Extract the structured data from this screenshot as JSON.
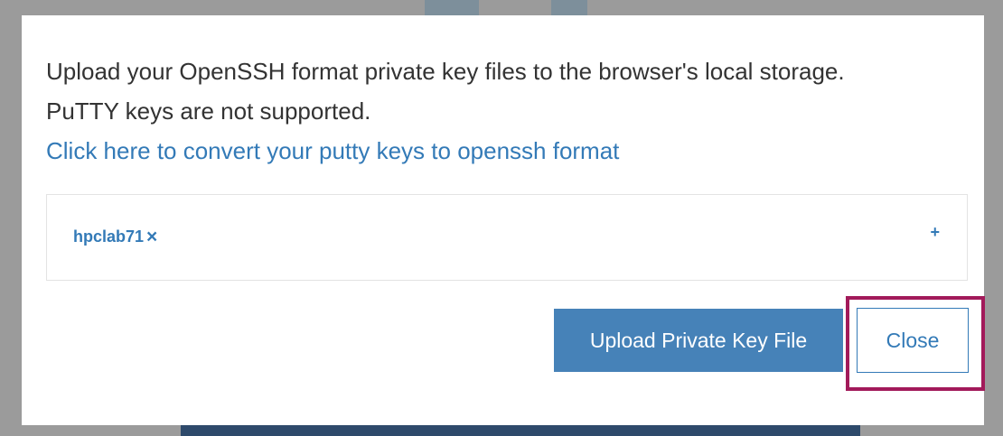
{
  "dialog": {
    "intro_line1": "Upload your OpenSSH format private key files to the browser's local storage.",
    "intro_line2": "PuTTY keys are not supported.",
    "convert_link": "Click here to convert your putty keys to openssh format"
  },
  "keys": {
    "items": [
      {
        "name": "hpclab71",
        "remove_icon": "×"
      }
    ],
    "add_icon": "+"
  },
  "buttons": {
    "upload_label": "Upload Private Key File",
    "close_label": "Close"
  },
  "colors": {
    "accent": "#337ab7",
    "primary_button": "#4682b8",
    "highlight": "#a21a5a"
  }
}
